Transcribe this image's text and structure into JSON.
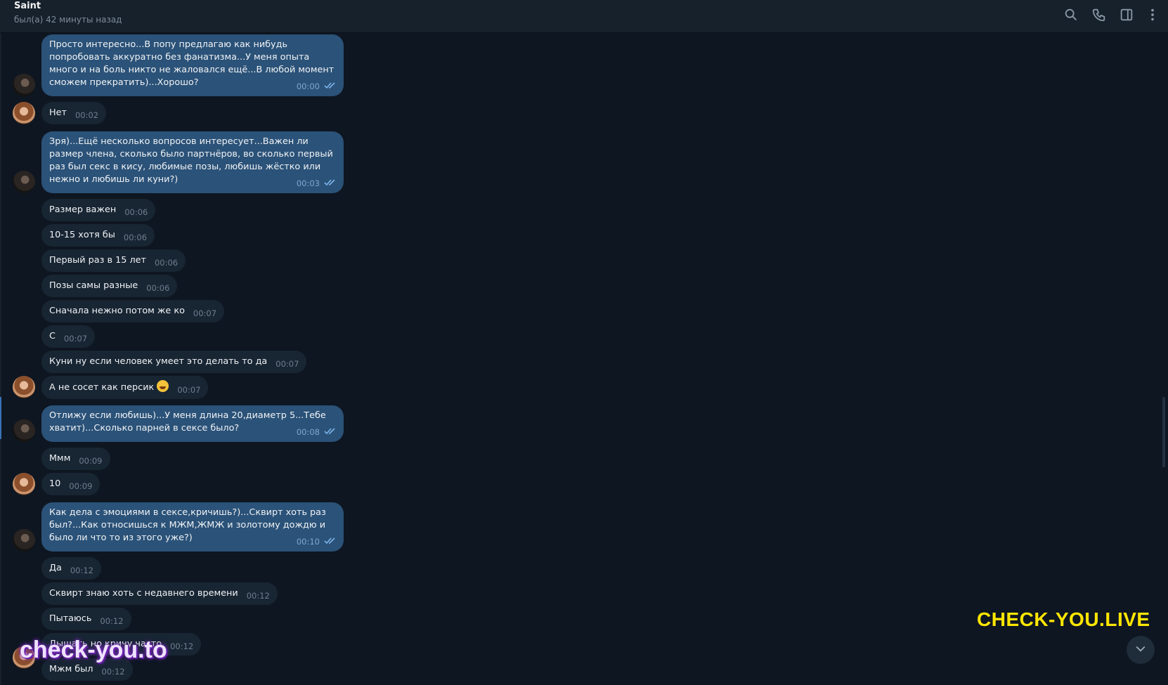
{
  "header": {
    "name": "Saint",
    "status": "был(а) 42 минуты назад"
  },
  "icons": [
    "search-icon",
    "phone-icon",
    "sidebar-toggle-icon",
    "more-vert-icon",
    "double-check-icon",
    "chevron-down-icon"
  ],
  "messages": [
    {
      "dir": "out",
      "text": "Просто интересно...В попу предлагаю как нибудь попробовать аккуратно без фанатизма...У меня опыта много и на боль никто не жаловался ещё...В любой момент сможем прекратить)...Хорошо?",
      "time": "00:00"
    },
    {
      "dir": "in",
      "text": "Нет",
      "time": "00:02"
    },
    {
      "dir": "out",
      "text": "Зря)...Ещё несколько вопросов интересует...Важен ли размер члена, сколько было партнёров, во сколько первый раз был секс в кису, любимые позы, любишь жёстко или нежно и любишь ли куни?)",
      "time": "00:03"
    },
    {
      "dir": "in",
      "text": "Размер важен",
      "time": "00:06"
    },
    {
      "dir": "in",
      "text": "10-15 хотя бы",
      "time": "00:06"
    },
    {
      "dir": "in",
      "text": "Первый раз в 15 лет",
      "time": "00:06"
    },
    {
      "dir": "in",
      "text": "Позы самы разные",
      "time": "00:06"
    },
    {
      "dir": "in",
      "text": "Сначала нежно потом же ко",
      "time": "00:07"
    },
    {
      "dir": "in",
      "text": "С",
      "time": "00:07"
    },
    {
      "dir": "in",
      "text": "Куни ну если человек умеет это делать то да",
      "time": "00:07"
    },
    {
      "dir": "in",
      "text": "А не сосет как персик",
      "time": "00:07"
    },
    {
      "dir": "out",
      "text": "Отлижу если любишь)...У меня длина 20,диаметр 5...Тебе хватит)...Сколько парней в сексе было?",
      "time": "00:08"
    },
    {
      "dir": "in",
      "text": "Ммм",
      "time": "00:09"
    },
    {
      "dir": "in",
      "text": "10",
      "time": "00:09"
    },
    {
      "dir": "out",
      "text": "Как дела с эмоциями в сексе,кричишь?)...Сквирт хоть раз был?...Как относишься к МЖМ,ЖМЖ и золотому дождю и было ли что то из этого уже?)",
      "time": "00:10"
    },
    {
      "dir": "in",
      "text": "Да",
      "time": "00:12"
    },
    {
      "dir": "in",
      "text": "Сквирт знаю хоть с недавнего времени",
      "time": "00:12"
    },
    {
      "dir": "in",
      "text": "Пытаюсь",
      "time": "00:12"
    },
    {
      "dir": "in",
      "text": "Дышать но кричу часто",
      "time": "00:12"
    },
    {
      "dir": "in",
      "text": "Мжм был",
      "time": "00:12"
    }
  ],
  "watermarks": {
    "yellow": "CHECK-YOU.LIVE",
    "purple": "check-you.to"
  },
  "colors": {
    "background": "#0e1621",
    "header": "#17212b",
    "incoming_bubble": "#182533",
    "outgoing_bubble": "#2b5278",
    "time_out": "#7da8d3",
    "watermark_yellow": "#ffe600"
  }
}
